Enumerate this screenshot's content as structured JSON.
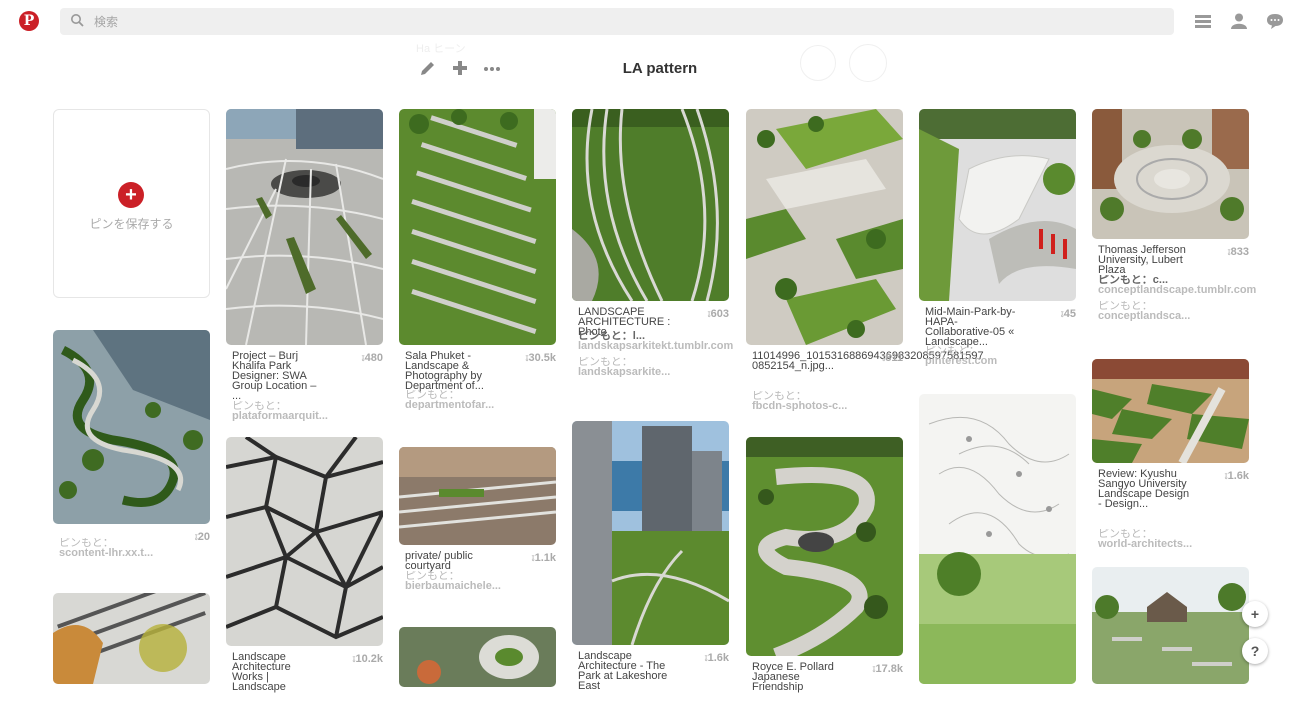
{
  "header": {
    "search_placeholder": "検索"
  },
  "board": {
    "title": "LA pattern",
    "faint_name": "Ha ヒーン"
  },
  "save_card": {
    "label": "ピンを保存する"
  },
  "pins": [
    {
      "desc": "Project – Burj Khalifa Park Designer: SWA Group Location – ...",
      "count": "480",
      "src_label": "ピンもと：",
      "src": "plataformaarquit..."
    },
    {
      "desc": "Sala Phuket - Landscape & Photography by Department of...",
      "count": "30.5k",
      "src_label": "ピンもと：",
      "src": "departmentofar..."
    },
    {
      "desc": "LANDSCAPE ARCHITECTURE : Photo",
      "count": "603",
      "via": "ピンもと：l...",
      "via_src": "landskapsarkitekt.tumblr.com",
      "src_label": "ピンもと：",
      "src": "landskapsarkite..."
    },
    {
      "desc": "11014996_10153168869436983208597581597 0852154_n.jpg...",
      "count": "811",
      "src_label": "ピンもと：",
      "src": "fbcdn-sphotos-c..."
    },
    {
      "desc": "Mid-Main-Park-by-HAPA-Collaborative-05 « Landscape...",
      "count": "45",
      "src_label": "ピンもと：",
      "src": "pinterest.com"
    },
    {
      "desc": "Thomas Jefferson University, Lubert Plaza",
      "count": "833",
      "via": "ピンもと：c...",
      "via_src": "conceptlandscape.tumblr.com",
      "src_label": "ピンもと：",
      "src": "conceptlandsca..."
    },
    {
      "desc": "",
      "count": "20",
      "src_label": "ピンもと：",
      "src": "scontent-lhr.xx.t..."
    },
    {
      "desc": "private/ public courtyard",
      "count": "1.1k",
      "src_label": "ピンもと：",
      "src": "bierbaumaichele..."
    },
    {
      "desc": "Review: Kyushu Sangyo University Landscape Design - Design...",
      "count": "1.6k",
      "src_label": "ピンもと：",
      "src": "world-architects..."
    },
    {
      "desc": "Landscape Architecture Works | Landscape",
      "count": "10.2k"
    },
    {
      "desc": "Landscape Architecture - The Park at Lakeshore East",
      "count": "1.6k"
    },
    {
      "desc": "Royce E. Pollard Japanese Friendship",
      "count": "17.8k"
    }
  ],
  "fabs": {
    "plus": "+",
    "help": "?"
  },
  "colors": {
    "brand": "#cb2027",
    "grass": "#5c8a2e",
    "paving": "#c9c9c4"
  }
}
